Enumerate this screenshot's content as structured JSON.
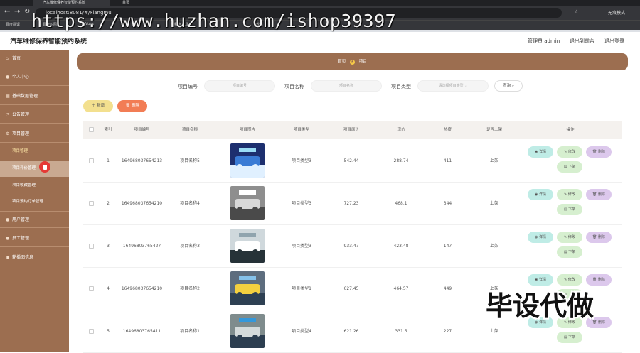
{
  "browser": {
    "tab_active": "汽车维修保养智能预约系统",
    "tab_other": "首页",
    "url": "localhost:8081/#/xiangmu",
    "profile": "无痕模式",
    "bookmarks": [
      "百度翻译",
      "百度识图",
      "Vuex",
      "开始",
      "小程序工具",
      "教程"
    ]
  },
  "watermark_text": "https://www.huzhan.com/ishop39397",
  "corner_watermark": "毕设代做",
  "header": {
    "title": "汽车维修保养智能预约系统",
    "admin": "管理员 admin",
    "back_front": "退出到前台",
    "logout": "退出登录"
  },
  "sidebar": {
    "items": [
      {
        "label": "首页",
        "icon": "home-icon"
      },
      {
        "label": "个人中心",
        "icon": "user-icon"
      },
      {
        "label": "基础数据管理",
        "icon": "grid-icon"
      },
      {
        "label": "公告管理",
        "icon": "bell-icon"
      },
      {
        "label": "项目管理",
        "icon": "gear-icon"
      }
    ],
    "subitems": [
      "项目管理",
      "项目评价管理",
      "项目收藏管理",
      "项目预约订单管理"
    ],
    "items_after": [
      {
        "label": "用户管理",
        "icon": "user-icon"
      },
      {
        "label": "员工管理",
        "icon": "user-icon"
      },
      {
        "label": "轮播图信息",
        "icon": "image-icon"
      }
    ]
  },
  "breadcrumb": {
    "home": "首页",
    "current": "项目"
  },
  "filters": {
    "code_label": "项目编号",
    "code_placeholder": "项目编号",
    "name_label": "项目名称",
    "name_placeholder": "项目名称",
    "type_label": "项目类型",
    "type_placeholder": "请选择项目类型",
    "search": "查询"
  },
  "actions": {
    "add": "新增",
    "delete": "删除"
  },
  "table": {
    "headers": [
      "索引",
      "项目编号",
      "项目名称",
      "项目图片",
      "项目类型",
      "项目原价",
      "现价",
      "热度",
      "是否上架",
      "操作"
    ],
    "row_buttons": {
      "detail": "详情",
      "edit": "修改",
      "delete": "删除",
      "down": "下架"
    },
    "rows": [
      {
        "idx": "1",
        "code": "164968037654213",
        "name": "项目名称5",
        "type": "项目类型3",
        "orig": "542.44",
        "price": "288.74",
        "heat": "411",
        "status": "上架"
      },
      {
        "idx": "2",
        "code": "164968037654210",
        "name": "项目名称4",
        "type": "项目类型3",
        "orig": "727.23",
        "price": "468.1",
        "heat": "344",
        "status": "上架"
      },
      {
        "idx": "3",
        "code": "16496803765427",
        "name": "项目名称3",
        "type": "项目类型3",
        "orig": "933.47",
        "price": "423.48",
        "heat": "147",
        "status": "上架"
      },
      {
        "idx": "4",
        "code": "164968037654210",
        "name": "项目名称2",
        "type": "项目类型1",
        "orig": "627.45",
        "price": "464.57",
        "heat": "449",
        "status": "上架"
      },
      {
        "idx": "5",
        "code": "16496803765411",
        "name": "项目名称1",
        "type": "项目类型4",
        "orig": "621.26",
        "price": "331.5",
        "heat": "227",
        "status": "上架"
      }
    ]
  },
  "colors": {
    "sidebar": "#9c6e50",
    "accent": "#f27d55",
    "add": "#f3e08f"
  }
}
